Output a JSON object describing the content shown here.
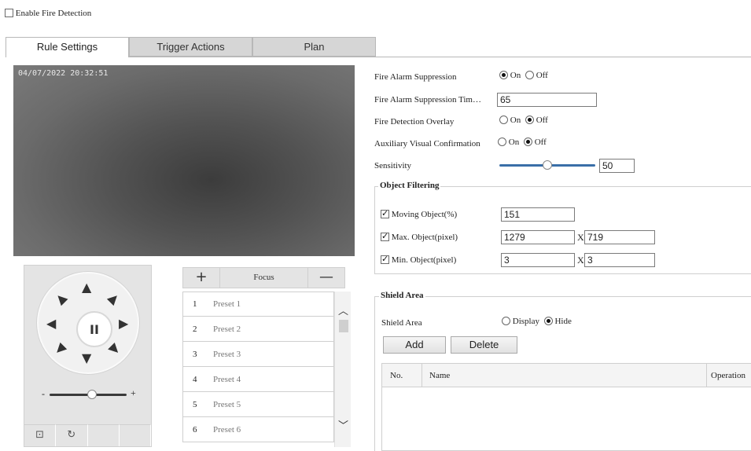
{
  "enable_fire_detection": {
    "label": "Enable Fire Detection",
    "checked": false
  },
  "tabs": [
    {
      "label": "Rule Settings",
      "active": true
    },
    {
      "label": "Trigger Actions",
      "active": false
    },
    {
      "label": "Plan",
      "active": false
    }
  ],
  "video": {
    "timestamp": "04/07/2022 20:32:51"
  },
  "ptz": {
    "icons": [
      "arrow-up-icon",
      "arrow-down-icon",
      "arrow-left-icon",
      "arrow-right-icon",
      "arrow-up-left-icon",
      "arrow-up-right-icon",
      "arrow-down-left-icon",
      "arrow-down-right-icon",
      "pause-icon",
      "lock-icon",
      "reset-icon"
    ],
    "speed_minus": "-",
    "speed_plus": "+",
    "pause_glyph": "II"
  },
  "focus": {
    "plus": "+",
    "label": "Focus",
    "minus": "—"
  },
  "presets": [
    {
      "num": "1",
      "name": "Preset 1"
    },
    {
      "num": "2",
      "name": "Preset 2"
    },
    {
      "num": "3",
      "name": "Preset 3"
    },
    {
      "num": "4",
      "name": "Preset 4"
    },
    {
      "num": "5",
      "name": "Preset 5"
    },
    {
      "num": "6",
      "name": "Preset 6"
    }
  ],
  "settings": {
    "suppression": {
      "label": "Fire Alarm Suppression",
      "on": "On",
      "off": "Off",
      "value": "On"
    },
    "suppression_time": {
      "label": "Fire Alarm Suppression Tim…",
      "value": "65"
    },
    "overlay": {
      "label": "Fire Detection Overlay",
      "on": "On",
      "off": "Off",
      "value": "Off"
    },
    "aux_visual": {
      "label": "Auxiliary Visual Confirmation",
      "on": "On",
      "off": "Off",
      "value": "Off"
    },
    "sensitivity": {
      "label": "Sensitivity",
      "value": "50",
      "level_percent": 50
    }
  },
  "object_filtering": {
    "title": "Object Filtering",
    "moving": {
      "label": "Moving Object(%)",
      "checked": true,
      "value": "151"
    },
    "max": {
      "label": "Max. Object(pixel)",
      "checked": true,
      "w": "1279",
      "sep": "X",
      "h": "719"
    },
    "min": {
      "label": "Min. Object(pixel)",
      "checked": true,
      "w": "3",
      "sep": "X",
      "h": "3"
    }
  },
  "shield_area": {
    "title": "Shield Area",
    "label": "Shield Area",
    "display": "Display",
    "hide": "Hide",
    "value": "Hide",
    "add": "Add",
    "delete": "Delete",
    "columns": [
      "No.",
      "Name",
      "Operation"
    ]
  },
  "colors": {
    "tab_inactive": "#d6d6d6",
    "panel_gray": "#e4e4e4",
    "border": "#cfcfcf"
  }
}
